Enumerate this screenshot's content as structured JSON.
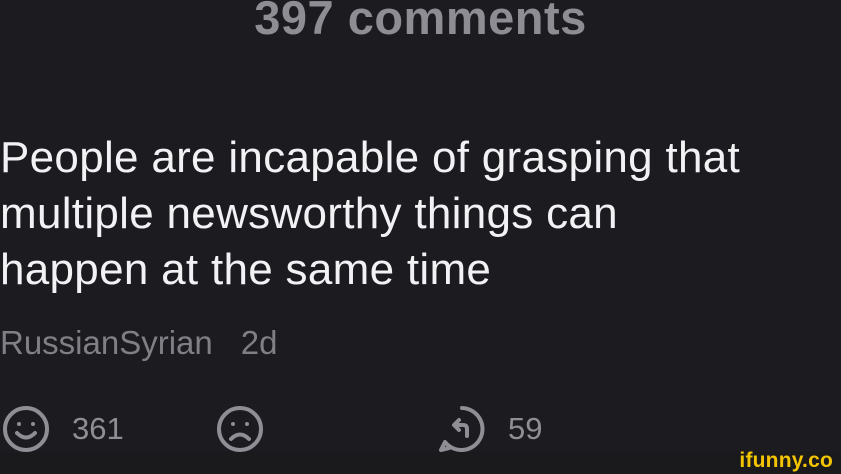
{
  "header": {
    "title": "397 comments"
  },
  "comment": {
    "text": "People are incapable of grasping that\nmultiple newsworthy things can\nhappen at the same time",
    "author": "RussianSyrian",
    "time": "2d"
  },
  "actions": {
    "like_count": "361",
    "reply_count": "59",
    "icons": {
      "like": "smile-icon",
      "dislike": "frown-icon",
      "reply": "reply-icon"
    }
  },
  "watermark": {
    "text": "ifunny.co"
  },
  "colors": {
    "background": "#1c1b20",
    "primary_text": "#f2f2f4",
    "secondary_text": "#8e8e94",
    "watermark": "#f3c400"
  }
}
